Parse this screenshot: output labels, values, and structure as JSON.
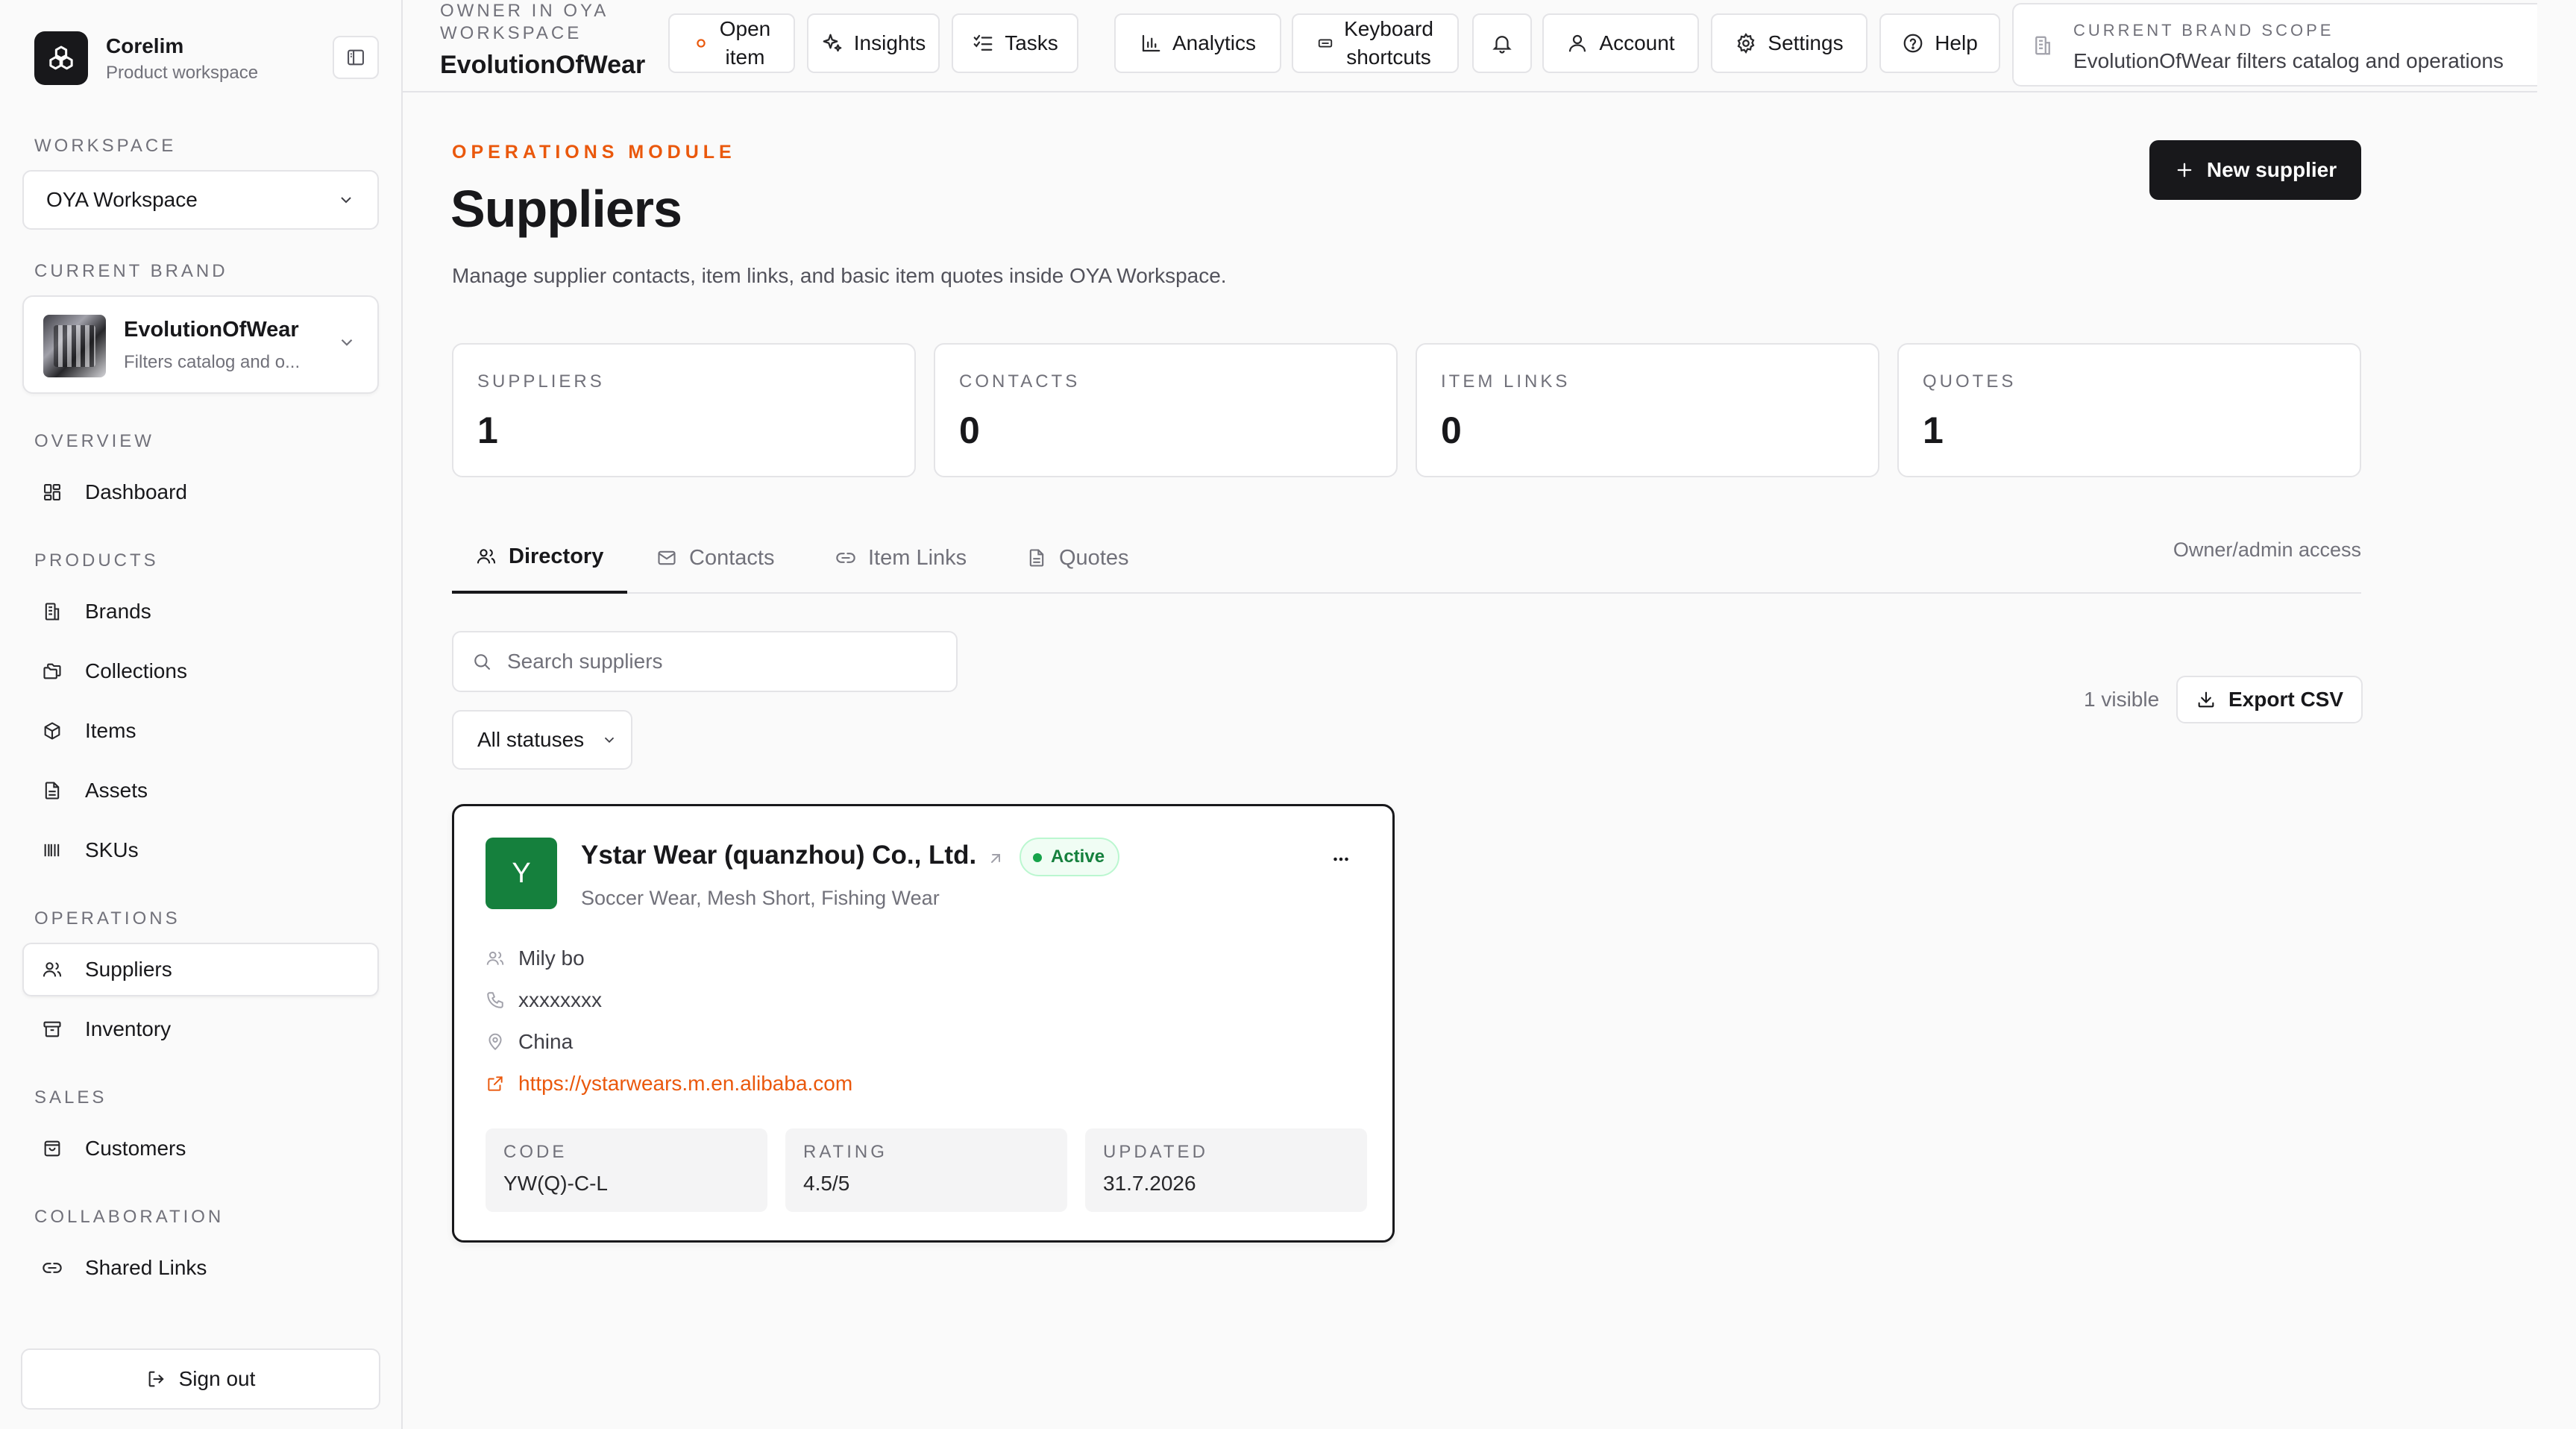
{
  "app": {
    "name": "Corelim",
    "subtitle": "Product workspace"
  },
  "sidebar": {
    "workspace_label": "WORKSPACE",
    "workspace_value": "OYA Workspace",
    "brand_label": "CURRENT BRAND",
    "brand": {
      "name": "EvolutionOfWear",
      "desc": "Filters catalog and o..."
    },
    "sections": {
      "overview": "OVERVIEW",
      "products": "PRODUCTS",
      "operations": "OPERATIONS",
      "sales": "SALES",
      "collaboration": "COLLABORATION"
    },
    "items": {
      "dashboard": "Dashboard",
      "brands": "Brands",
      "collections": "Collections",
      "items": "Items",
      "assets": "Assets",
      "skus": "SKUs",
      "suppliers": "Suppliers",
      "inventory": "Inventory",
      "customers": "Customers",
      "shared_links": "Shared Links"
    },
    "signout": "Sign out"
  },
  "topbar": {
    "owner_label": "OWNER IN OYA WORKSPACE",
    "owner_name": "EvolutionOfWear",
    "open_item_1": "Open",
    "open_item_2": "item",
    "insights": "Insights",
    "tasks": "Tasks",
    "analytics": "Analytics",
    "shortcuts_1": "Keyboard",
    "shortcuts_2": "shortcuts",
    "account": "Account",
    "settings": "Settings",
    "help": "Help",
    "scope_label": "CURRENT BRAND SCOPE",
    "scope_text": "EvolutionOfWear filters catalog and operations"
  },
  "page": {
    "eyebrow": "OPERATIONS MODULE",
    "title": "Suppliers",
    "description": "Manage supplier contacts, item links, and basic item quotes inside OYA Workspace.",
    "new_button": "New supplier"
  },
  "stats": [
    {
      "label": "SUPPLIERS",
      "value": "1"
    },
    {
      "label": "CONTACTS",
      "value": "0"
    },
    {
      "label": "ITEM LINKS",
      "value": "0"
    },
    {
      "label": "QUOTES",
      "value": "1"
    }
  ],
  "tabs": {
    "directory": "Directory",
    "contacts": "Contacts",
    "item_links": "Item Links",
    "quotes": "Quotes",
    "access": "Owner/admin access"
  },
  "toolbar": {
    "search_placeholder": "Search suppliers",
    "status_filter": "All statuses",
    "visible_count": "1 visible",
    "export": "Export CSV"
  },
  "supplier": {
    "initial": "Y",
    "name": "Ystar Wear (quanzhou) Co., Ltd.",
    "status": "Active",
    "categories": "Soccer Wear, Mesh Short, Fishing Wear",
    "contact": "Mily bo",
    "phone": "xxxxxxxx",
    "country": "China",
    "url": "https://ystarwears.m.en.alibaba.com",
    "code_label": "CODE",
    "code": "YW(Q)-C-L",
    "rating_label": "RATING",
    "rating": "4.5/5",
    "updated_label": "UPDATED",
    "updated": "31.7.2026"
  },
  "colors": {
    "accent": "#ea580c",
    "primary": "#18181b",
    "success": "#15803d",
    "border": "#e4e4e7",
    "muted": "#71717a"
  }
}
